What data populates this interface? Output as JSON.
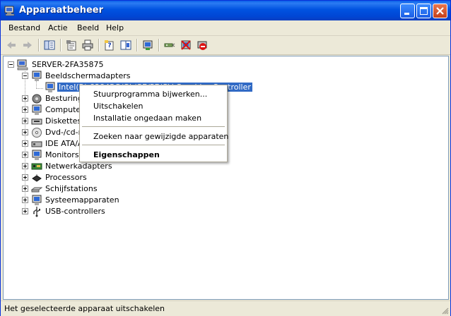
{
  "window": {
    "title": "Apparaatbeheer",
    "icon": "device-manager-icon"
  },
  "title_buttons": [
    "minimize-icon",
    "maximize-icon",
    "close-icon"
  ],
  "menubar": {
    "items": [
      "Bestand",
      "Actie",
      "Beeld",
      "Help"
    ]
  },
  "toolbar": {
    "icons": [
      "back-arrow-icon",
      "forward-arrow-icon",
      "show-hide-tree-icon",
      "properties-icon",
      "print-icon",
      "help-icon",
      "help-topics-icon",
      "update-driver-icon",
      "scan-hardware-icon",
      "uninstall-icon",
      "disable-icon"
    ]
  },
  "tree": {
    "root": "SERVER-2FA35875",
    "categories": [
      {
        "label": "Beeldschermadapters",
        "expanded": true,
        "children": [
          "Intel(R) 82845G/GL/GE/PE/GV Graphics Controller"
        ]
      },
      {
        "label": "Besturing"
      },
      {
        "label": "Computer"
      },
      {
        "label": "Diskettest"
      },
      {
        "label": "Dvd-/cd-ro"
      },
      {
        "label": "IDE ATA/A"
      },
      {
        "label": "Monitors"
      },
      {
        "label": "Netwerkadapters"
      },
      {
        "label": "Processors"
      },
      {
        "label": "Schijfstations"
      },
      {
        "label": "Systeemapparaten"
      },
      {
        "label": "USB-controllers"
      }
    ],
    "selected_child_visible": "Intel(R) 82845G/GL/GE/PE/GV Graphics Controller"
  },
  "context_menu": {
    "items": [
      "Stuurprogramma bijwerken...",
      "Uitschakelen",
      "Installatie ongedaan maken",
      "Zoeken naar gewijzigde apparaten",
      "Eigenschappen"
    ],
    "default_item": "Eigenschappen"
  },
  "statusbar": {
    "text": "Het geselecteerde apparaat uitschakelen"
  },
  "colors": {
    "title_bar": "#0a5fe8",
    "selection": "#316ac5",
    "menu_face": "#ece9d8"
  }
}
